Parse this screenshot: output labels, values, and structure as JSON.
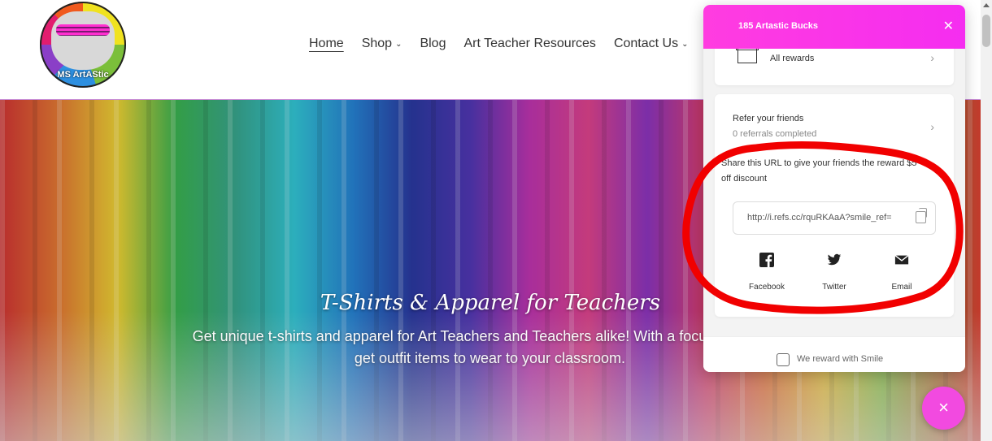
{
  "site": {
    "logo_text": "MS ArtAStic",
    "nav": [
      {
        "label": "Home",
        "active": true,
        "has_dropdown": false
      },
      {
        "label": "Shop",
        "active": false,
        "has_dropdown": true
      },
      {
        "label": "Blog",
        "active": false,
        "has_dropdown": false
      },
      {
        "label": "Art Teacher Resources",
        "active": false,
        "has_dropdown": false
      },
      {
        "label": "Contact Us",
        "active": false,
        "has_dropdown": true
      }
    ]
  },
  "hero": {
    "title": "T-Shirts & Apparel for Teachers",
    "subtitle": "Get unique t-shirts and apparel for Art Teachers and Teachers alike! With a focus on art teac... get outfit items to wear to your classroom.",
    "subtitle_line1": "Get unique t-shirts and apparel for Art Teachers and Teachers alike! With a focus on art teac",
    "subtitle_line2": "get outfit items to wear to your classroom."
  },
  "rewards_panel": {
    "header_title": "185 Artastic Bucks",
    "close_icon": "close-icon",
    "all_rewards_label": "All rewards",
    "refer_title": "Refer your friends",
    "referrals_completed": "0 referrals completed",
    "share_text": "Share this URL to give your friends the reward $5 off discount",
    "referral_url": "http://i.refs.cc/rquRKAaA?smile_ref=",
    "share_buttons": [
      {
        "label": "Facebook",
        "icon": "facebook-icon"
      },
      {
        "label": "Twitter",
        "icon": "twitter-icon"
      },
      {
        "label": "Email",
        "icon": "email-icon"
      }
    ],
    "footer_text": "We reward with Smile"
  },
  "launcher": {
    "icon": "close-icon",
    "symbol": "×"
  },
  "colors": {
    "accent": "#f52df0",
    "annotation": "#ff0000"
  }
}
